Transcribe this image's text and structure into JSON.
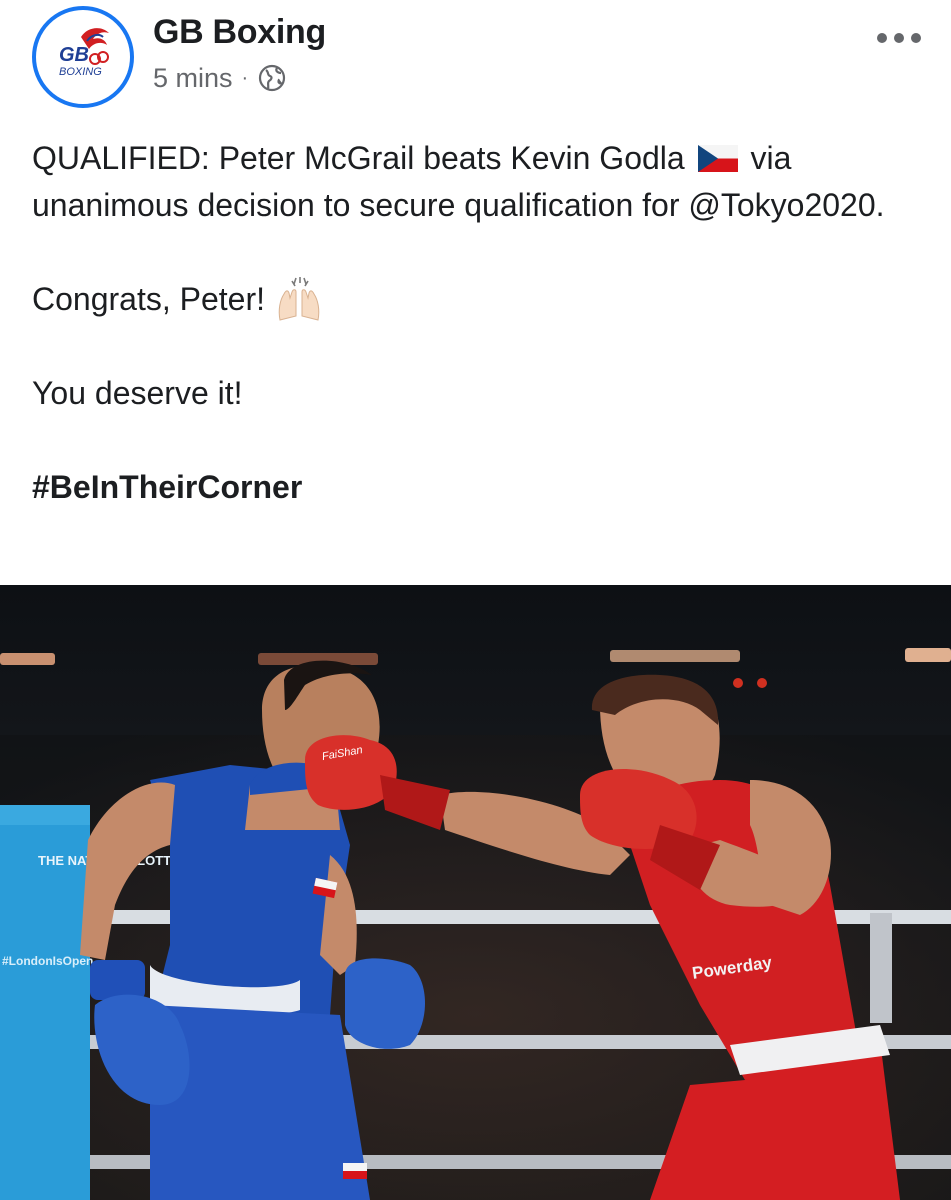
{
  "post": {
    "page_name": "GB Boxing",
    "time": "5 mins",
    "separator": "·",
    "privacy_icon": "globe-icon",
    "more_icon": "more-options-icon",
    "logo": {
      "text_gb": "GB",
      "text_boxing": "BOXING"
    },
    "text": {
      "line1_before_flag": "QUALIFIED: Peter McGrail beats Kevin Godla",
      "flag_icon": "czech-flag-icon",
      "line1_after_flag": "via unanimous decision to secure qualification for @Tokyo2020.",
      "line2": "Congrats, Peter!",
      "line2_icon": "raising-hands-icon",
      "line3": "You deserve it!",
      "hashtag": "#BeInTheirCorner"
    },
    "photo": {
      "corner_pad_text": "THE NATIONAL LOTTERY",
      "side_text": "#LondonIsOpen",
      "red_glove_brand": "FaiShan",
      "red_vest_sponsor": "Powerday"
    }
  },
  "colors": {
    "accent": "#1877f2",
    "text": "#1c1e21",
    "muted": "#65676b",
    "blue_vest": "#1f4fb4",
    "red_vest": "#d11f22",
    "corner_pad": "#2a9cd8"
  }
}
